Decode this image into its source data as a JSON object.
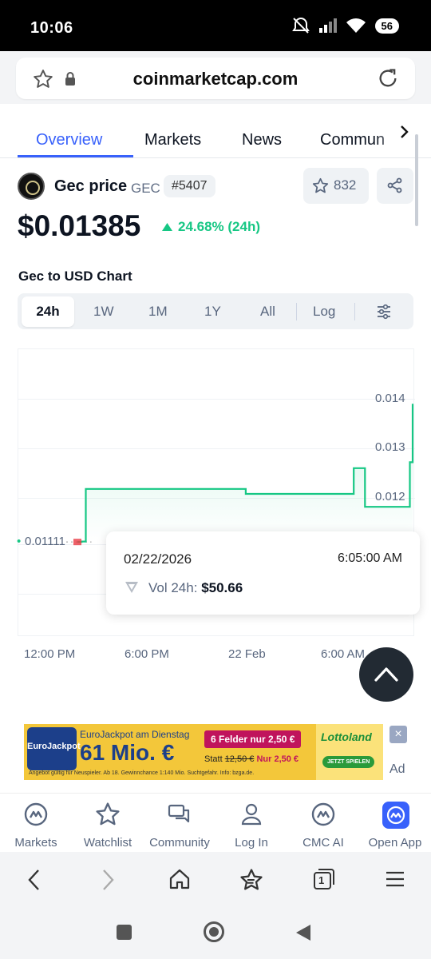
{
  "status_bar": {
    "time": "10:06",
    "battery": "56"
  },
  "browser": {
    "url": "coinmarketcap.com"
  },
  "tabs": [
    {
      "label": "Overview",
      "active": true
    },
    {
      "label": "Markets"
    },
    {
      "label": "News"
    },
    {
      "label": "Commun"
    }
  ],
  "coin": {
    "name": "Gec price",
    "symbol": "GEC",
    "rank": "#5407",
    "watchlist_count": "832"
  },
  "price": {
    "value": "$0.01385",
    "change": "24.68% (24h)",
    "change_color": "#16c784"
  },
  "chart": {
    "title": "Gec to USD Chart",
    "ranges": [
      "24h",
      "1W",
      "1M",
      "1Y",
      "All",
      "Log"
    ],
    "active_range": "24h"
  },
  "tooltip": {
    "date": "02/22/2026",
    "time": "6:05:00 AM",
    "vol_label": "Vol 24h:",
    "vol_value": "$50.66"
  },
  "chart_data": {
    "type": "line",
    "xlabels": [
      "12:00 PM",
      "6:00 PM",
      "22 Feb",
      "6:00 AM"
    ],
    "yticks": [
      "0.014",
      "0.013",
      "0.012"
    ],
    "open_label": "0.01111",
    "ylim": [
      0.0105,
      0.0145
    ],
    "series": [
      {
        "x": [
          0,
          0.3,
          0.6,
          0.9,
          1.2,
          3.0,
          6.0,
          9.0,
          12.0,
          14.0,
          17.0,
          19.6,
          19.7,
          20.4,
          20.5,
          22.0,
          23.6,
          23.7,
          23.9
        ],
        "y": [
          0.01111,
          0.01112,
          0.01218,
          0.01218,
          0.01218,
          0.01218,
          0.01218,
          0.01218,
          0.01208,
          0.01208,
          0.01208,
          0.01208,
          0.0126,
          0.0126,
          0.01182,
          0.01182,
          0.01182,
          0.01272,
          0.0139
        ]
      }
    ],
    "line_color": "#16c784",
    "grid": true
  },
  "ad": {
    "title": "EuroJackpot am Dienstag",
    "amount": "61 Mio. €",
    "brand": "EuroJackpot",
    "offer": "6 Felder nur 2,50 €",
    "statt": "Statt",
    "old_price": "12,50 €",
    "new_price": "Nur 2,50 €",
    "disclaimer": "Angebot gültig für Neuspieler. Ab 18. Gewinnchance 1:140 Mio. Suchtgefahr. Info: bzga.de.",
    "lotto_brand": "Lottoland",
    "cta": "JETZT SPIELEN",
    "ad_label": "Ad"
  },
  "bottom_nav": [
    {
      "label": "Markets",
      "icon": "cmc-logo-icon"
    },
    {
      "label": "Watchlist",
      "icon": "star-icon"
    },
    {
      "label": "Community",
      "icon": "chat-icon"
    },
    {
      "label": "Log In",
      "icon": "user-icon"
    },
    {
      "label": "CMC AI",
      "icon": "cmc-ai-icon"
    },
    {
      "label": "Open App",
      "icon": "open-app-icon"
    }
  ],
  "browser_nav": {
    "tab_count": "1"
  }
}
